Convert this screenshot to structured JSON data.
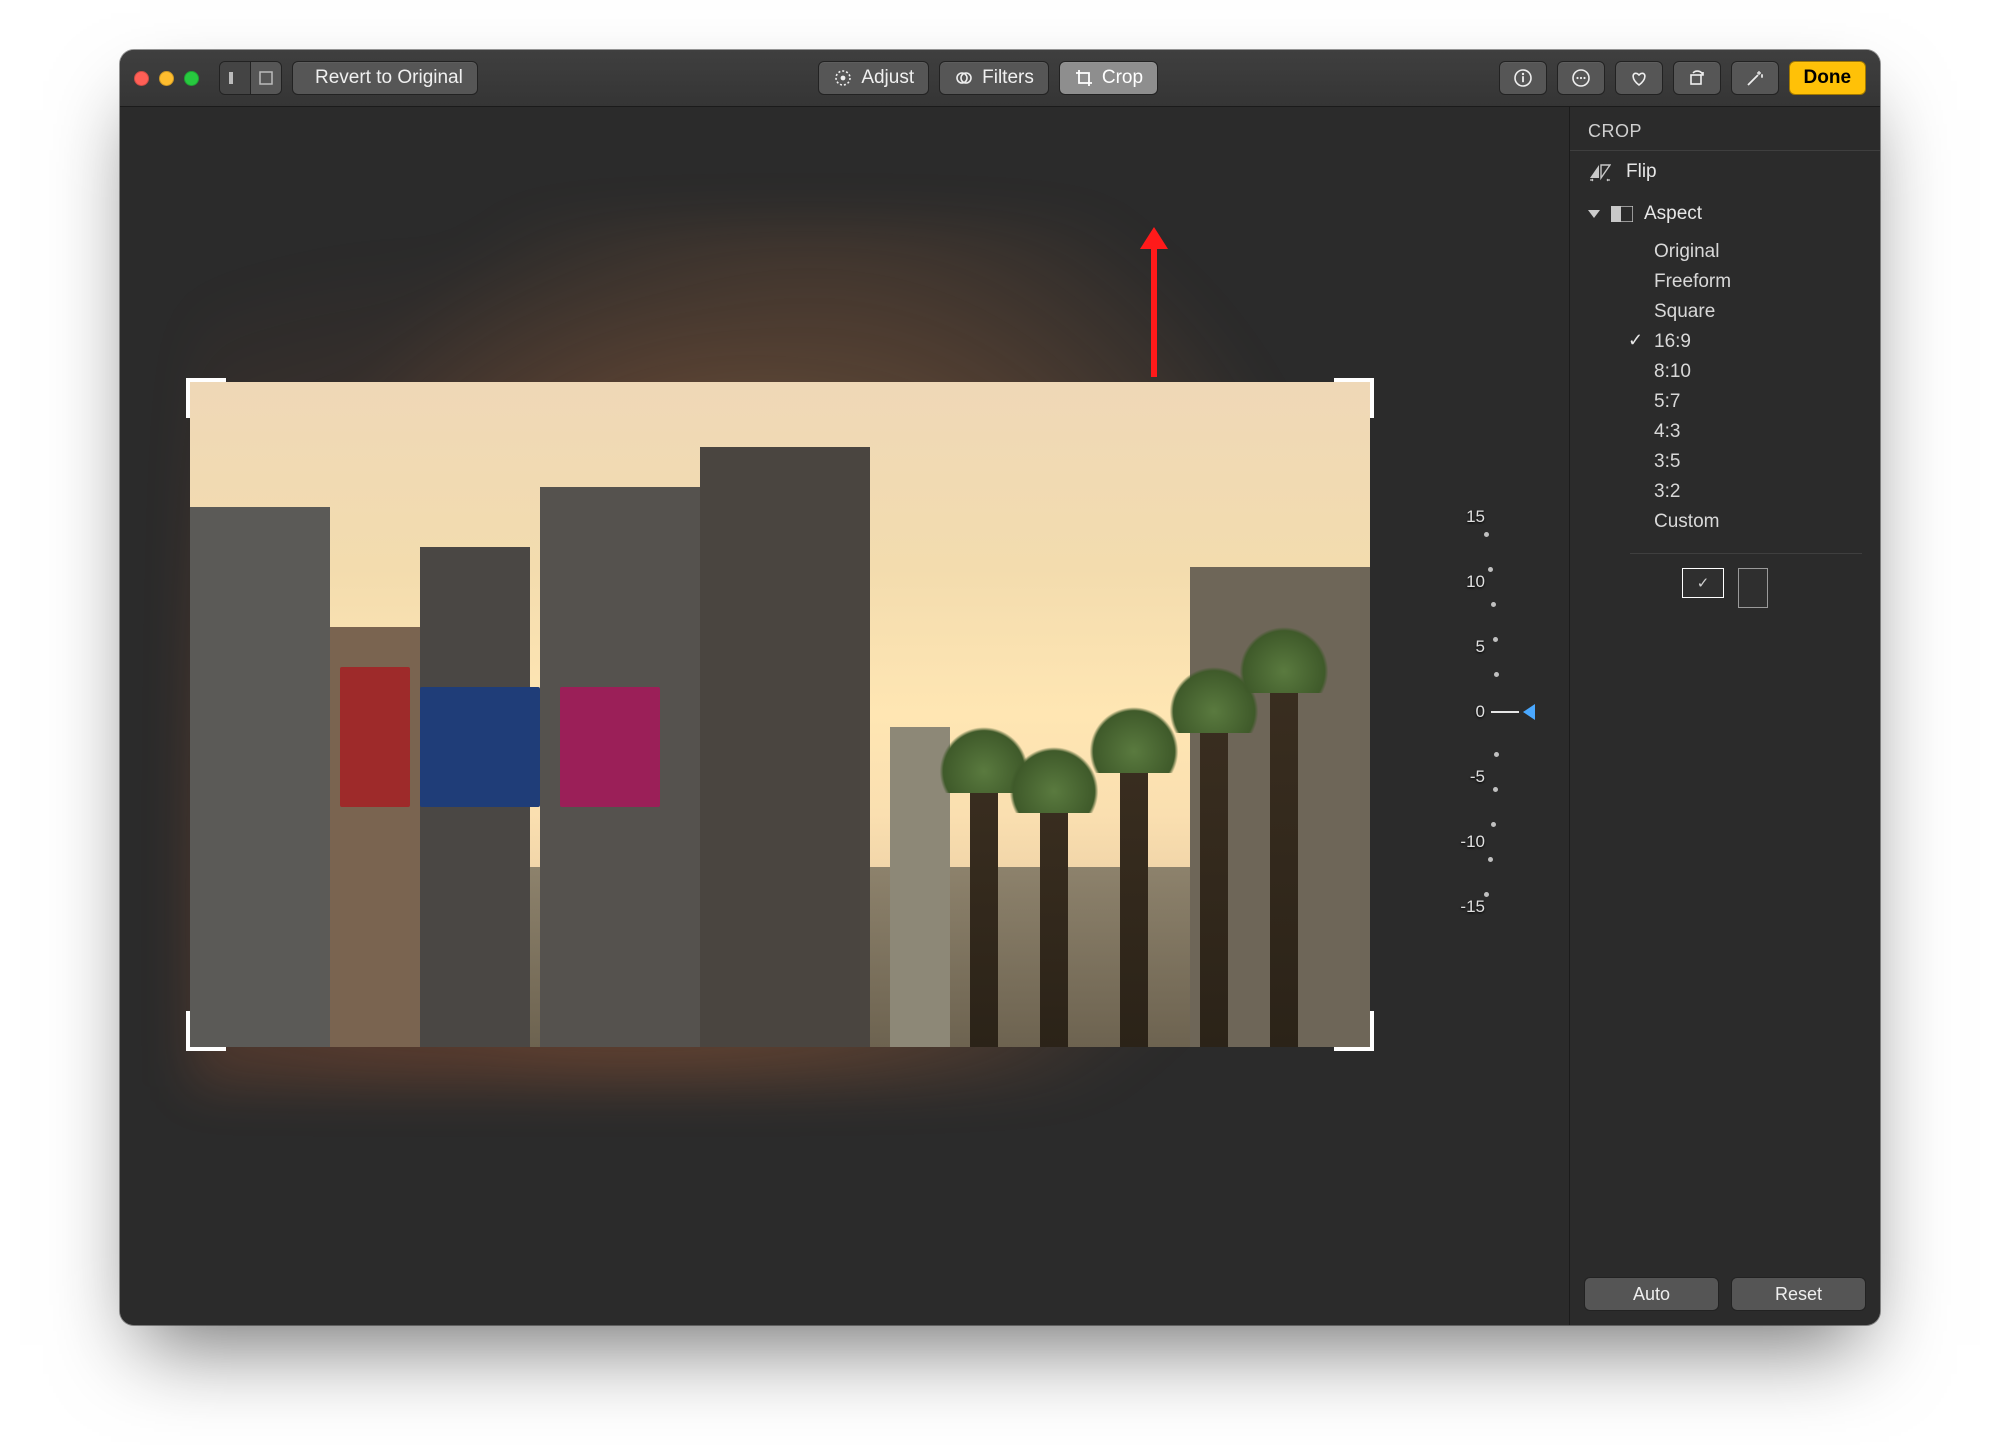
{
  "toolbar": {
    "revert_label": "Revert to Original",
    "adjust_label": "Adjust",
    "filters_label": "Filters",
    "crop_label": "Crop",
    "done_label": "Done"
  },
  "sidebar": {
    "title": "CROP",
    "flip_label": "Flip",
    "aspect_label": "Aspect",
    "aspect_options": {
      "original": "Original",
      "freeform": "Freeform",
      "square": "Square",
      "r16_9": "16:9",
      "r8_10": "8:10",
      "r5_7": "5:7",
      "r4_3": "4:3",
      "r3_5": "3:5",
      "r3_2": "3:2",
      "custom": "Custom"
    },
    "selected_aspect": "r16_9",
    "orientation_check": "✓"
  },
  "footer": {
    "auto_label": "Auto",
    "reset_label": "Reset"
  },
  "dial": {
    "pos15": "15",
    "pos10": "10",
    "pos5": "5",
    "zero": "0",
    "neg5": "-5",
    "neg10": "-10",
    "neg15": "-15"
  }
}
